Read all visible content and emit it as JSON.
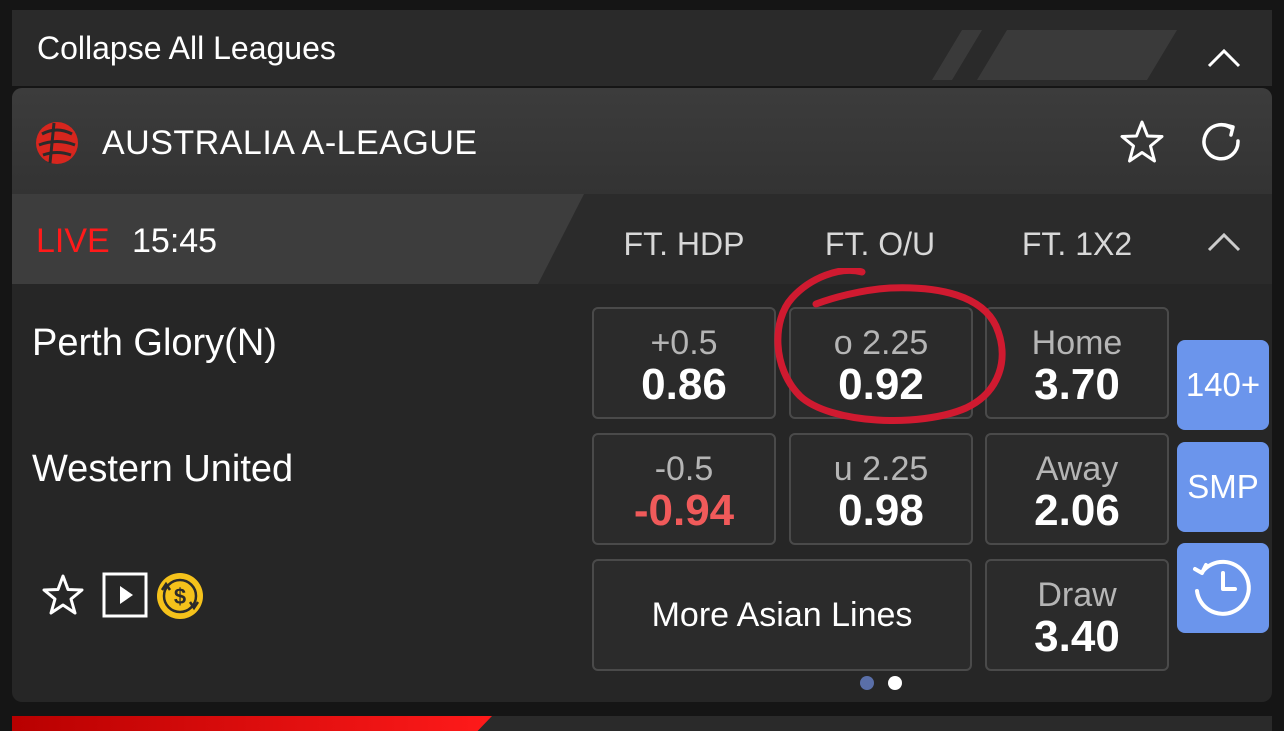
{
  "header": {
    "collapse_label": "Collapse All Leagues"
  },
  "league": {
    "name": "AUSTRALIA A-LEAGUE"
  },
  "match": {
    "status": "LIVE",
    "clock": "15:45",
    "columns": [
      "FT. HDP",
      "FT. O/U",
      "FT. 1X2"
    ],
    "home_team": "Perth Glory(N)",
    "away_team": "Western United",
    "hdp": {
      "home": {
        "line": "+0.5",
        "price": "0.86"
      },
      "away": {
        "line": "-0.5",
        "price": "-0.94"
      }
    },
    "ou": {
      "over": {
        "line": "o 2.25",
        "price": "0.92"
      },
      "under": {
        "line": "u 2.25",
        "price": "0.98"
      }
    },
    "x12": {
      "home": {
        "label": "Home",
        "price": "3.70"
      },
      "away": {
        "label": "Away",
        "price": "2.06"
      },
      "draw": {
        "label": "Draw",
        "price": "3.40"
      }
    },
    "more_lines_label": "More Asian Lines"
  },
  "side_buttons": {
    "markets": "140+",
    "smp": "SMP"
  },
  "colors": {
    "live": "#ff1a1a",
    "negative_price": "#f05a5a",
    "side_button": "#6b95ec",
    "annotation_circle": "#d01a30",
    "dot_active": "#ffffff",
    "dot_inactive": "#5a6fa8",
    "cashout_icon": "#f5c21b"
  },
  "icons": [
    "chevron-up-icon",
    "league-logo-icon",
    "star-icon",
    "refresh-icon",
    "video-play-icon",
    "cash-out-icon",
    "history-clock-icon"
  ],
  "pager": {
    "pages": 2,
    "current": 2
  }
}
